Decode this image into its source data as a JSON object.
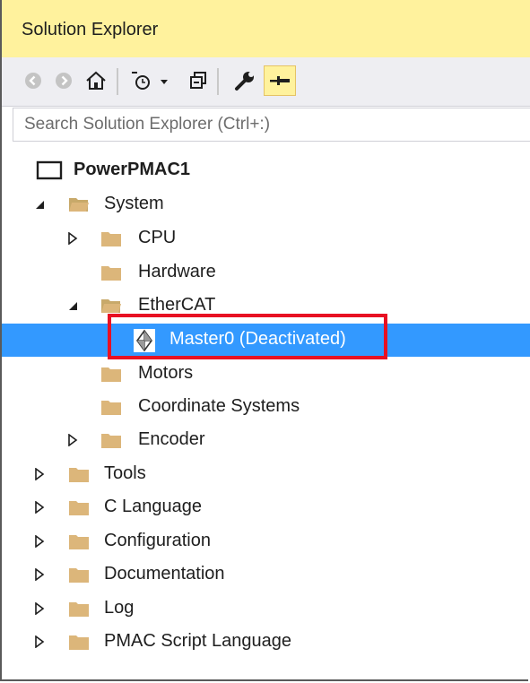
{
  "panel": {
    "title": "Solution Explorer"
  },
  "toolbar": {
    "back_icon": "back-arrow-icon",
    "forward_icon": "forward-arrow-icon",
    "home_icon": "home-icon",
    "pending_changes_icon": "history-clock-icon",
    "collapse_all_icon": "collapse-all-icon",
    "properties_icon": "wrench-icon",
    "pin_icon": "pin-icon"
  },
  "search": {
    "placeholder": "Search Solution Explorer (Ctrl+:)"
  },
  "tree": {
    "root": "PowerPMAC1",
    "items": [
      {
        "label": "System"
      },
      {
        "label": "CPU"
      },
      {
        "label": "Hardware"
      },
      {
        "label": "EtherCAT"
      },
      {
        "label": "Master0 (Deactivated)"
      },
      {
        "label": "Motors"
      },
      {
        "label": "Coordinate Systems"
      },
      {
        "label": "Encoder"
      },
      {
        "label": "Tools"
      },
      {
        "label": "C Language"
      },
      {
        "label": "Configuration"
      },
      {
        "label": "Documentation"
      },
      {
        "label": "Log"
      },
      {
        "label": "PMAC Script Language"
      }
    ]
  },
  "colors": {
    "title_bg": "#fff29d",
    "selection": "#3399ff",
    "folder": "#dcb67a",
    "highlight_border": "#e81123"
  }
}
